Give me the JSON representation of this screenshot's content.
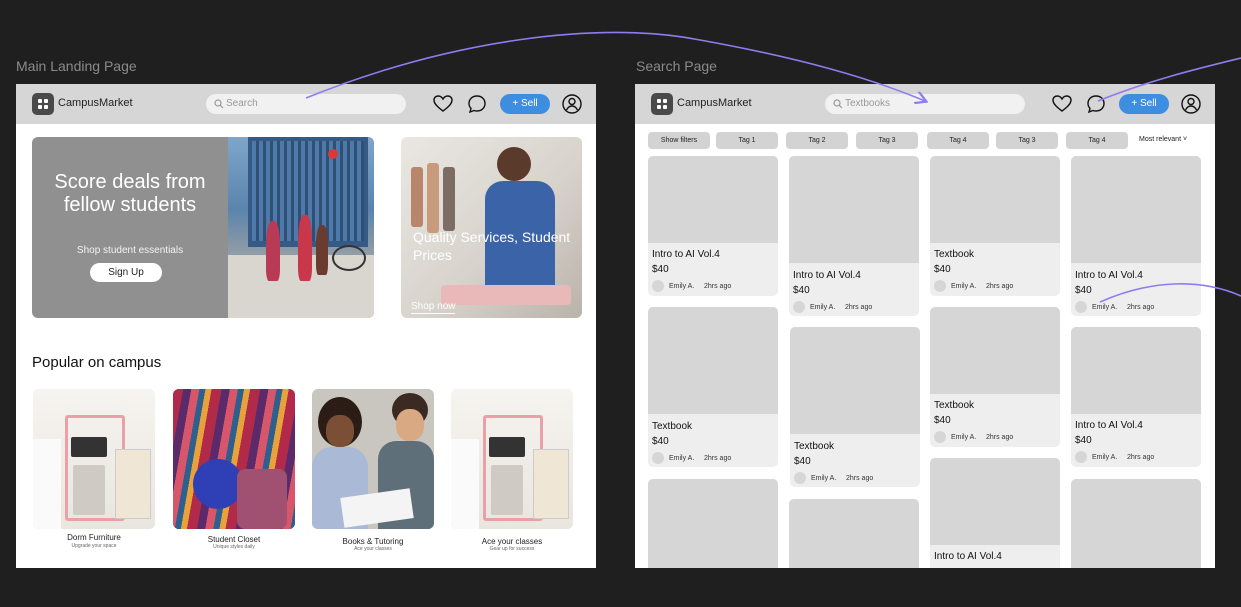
{
  "frames": {
    "landing_label": "Main Landing Page",
    "search_label": "Search Page"
  },
  "topbar": {
    "brand": "CampusMarket",
    "landing_search_placeholder": "Search",
    "search_page_value": "Textbooks",
    "sell_label": "+ Sell"
  },
  "hero": {
    "title": "Score deals from fellow students",
    "subtitle": "Shop student essentials",
    "cta": "Sign Up"
  },
  "services": {
    "title": "Quality Services, Student Prices",
    "cta": "Shop now"
  },
  "popular": {
    "title": "Popular on campus",
    "items": [
      {
        "name": "Dorm Furniture",
        "sub": "Upgrade your space"
      },
      {
        "name": "Student Closet",
        "sub": "Unique styles daily"
      },
      {
        "name": "Books & Tutoring",
        "sub": "Ace your classes"
      },
      {
        "name": "Ace your classes",
        "sub": "Gear up for success"
      }
    ]
  },
  "filters": {
    "show_filters": "Show filters",
    "tags": [
      "Tag 1",
      "Tag 2",
      "Tag 3",
      "Tag 4",
      "Tag 3",
      "Tag 4"
    ],
    "sort": "Most relevant ˅"
  },
  "listings": [
    {
      "title": "Intro to AI Vol.4",
      "price": "$40",
      "seller": "Emily A.",
      "time": "2hrs ago"
    },
    {
      "title": "Textbook",
      "price": "$40",
      "seller": "Emily A.",
      "time": "2hrs ago"
    },
    {
      "title": "Intro to AI Vol.4",
      "price": "$40",
      "seller": "Emily A.",
      "time": "2hrs ago"
    },
    {
      "title": "Textbook",
      "price": "$40",
      "seller": "Emily A.",
      "time": "2hrs ago"
    },
    {
      "title": "Textbook",
      "price": "$40",
      "seller": "Emily A.",
      "time": "2hrs ago"
    },
    {
      "title": "Textbook",
      "price": "$40",
      "seller": "Emily A.",
      "time": "2hrs ago"
    },
    {
      "title": "Intro to AI Vol.4",
      "price": "$40",
      "seller": "Emily A.",
      "time": "2hrs ago"
    },
    {
      "title": "Intro to AI Vol.4",
      "price": "$40",
      "seller": "Emily A.",
      "time": "2hrs ago"
    },
    {
      "title": "Intro to AI Vol.4"
    }
  ],
  "colors": {
    "canvas": "#1f1f1f",
    "accent": "#3d8de0",
    "flow_arrow": "#8f7cf0"
  },
  "icons": [
    "search-icon",
    "heart-icon",
    "chat-icon",
    "user-icon",
    "grid-logo-icon"
  ]
}
